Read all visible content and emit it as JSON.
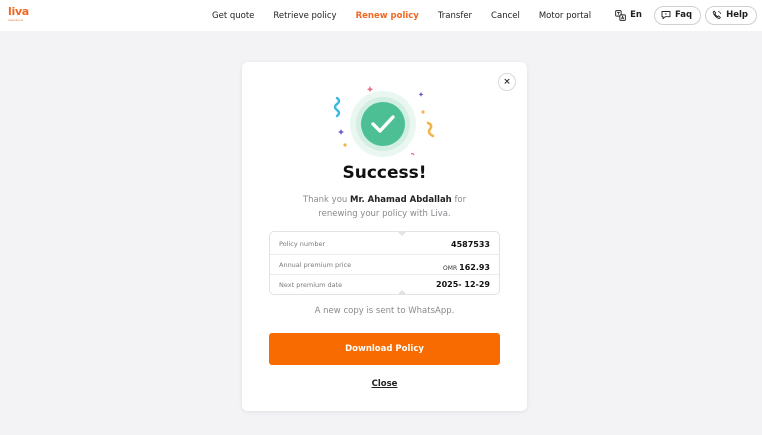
{
  "header": {
    "logo_text": "liva",
    "logo_sub": "insurance",
    "nav": [
      {
        "label": "Get quote",
        "active": false
      },
      {
        "label": "Retrieve policy",
        "active": false
      },
      {
        "label": "Renew policy",
        "active": true
      },
      {
        "label": "Transfer",
        "active": false
      },
      {
        "label": "Cancel",
        "active": false
      },
      {
        "label": "Motor portal",
        "active": false
      }
    ],
    "language": "En",
    "faq_label": "Faq",
    "help_label": "Help"
  },
  "modal": {
    "title": "Success!",
    "message_prefix": "Thank you",
    "customer_name": "Mr. Ahamad Abdallah",
    "message_suffix": "for renewing your policy with Liva.",
    "details": [
      {
        "label": "Policy number",
        "currency": "",
        "value": "4587533"
      },
      {
        "label": "Annual premium price",
        "currency": "OMR",
        "value": "162.93"
      },
      {
        "label": "Next premium date",
        "currency": "",
        "value": "2025- 12-29"
      }
    ],
    "sent_note": "A new copy is sent to WhatsApp.",
    "download_label": "Download Policy",
    "close_label": "Close",
    "close_icon": "×"
  },
  "colors": {
    "brand": "#f26722",
    "button": "#f76b00",
    "success": "#4cbf95",
    "background": "#f3f3f6"
  }
}
